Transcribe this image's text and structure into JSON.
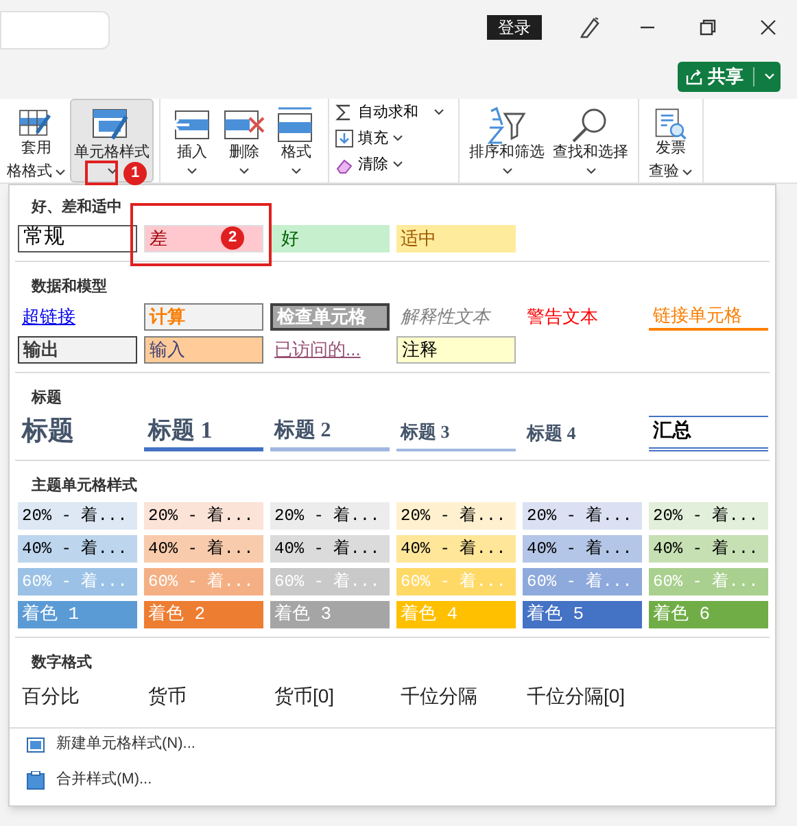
{
  "title_bar": {
    "login_button": "登录"
  },
  "share_button": {
    "label": "共享"
  },
  "ribbon": {
    "groups": [
      {
        "kind": "big",
        "items": [
          {
            "label": "套用",
            "label2": "格格式",
            "selected": false
          },
          {
            "label": "单元格样式",
            "selected": true
          }
        ]
      },
      {
        "kind": "big",
        "items": [
          {
            "label": "插入",
            "selected": false
          },
          {
            "label": "删除",
            "selected": false
          },
          {
            "label": "格式",
            "selected": false
          }
        ]
      },
      {
        "kind": "small",
        "items": [
          {
            "label": "自动求和"
          },
          {
            "label": "填充"
          },
          {
            "label": "清除"
          }
        ]
      },
      {
        "kind": "big",
        "items": [
          {
            "label": "排序和筛选",
            "selected": false
          },
          {
            "label": "查找和选择",
            "selected": false
          }
        ]
      },
      {
        "kind": "big",
        "items": [
          {
            "label": "发票",
            "label2": "查验",
            "selected": false
          }
        ]
      }
    ]
  },
  "style_gallery": {
    "sections": [
      {
        "title": "好、差和适中",
        "rows": [
          [
            {
              "label": "常规",
              "kind": "normal"
            },
            {
              "label": "差",
              "kind": "bad"
            },
            {
              "label": "好",
              "kind": "good"
            },
            {
              "label": "适中",
              "kind": "neutral"
            }
          ]
        ]
      },
      {
        "title": "数据和模型",
        "rows": [
          [
            {
              "label": "超链接",
              "kind": "hyperlink"
            },
            {
              "label": "计算",
              "kind": "calculation"
            },
            {
              "label": "检查单元格",
              "kind": "check"
            },
            {
              "label": "解释性文本",
              "kind": "explanatory"
            },
            {
              "label": "警告文本",
              "kind": "warning"
            },
            {
              "label": "链接单元格",
              "kind": "linked"
            }
          ],
          [
            {
              "label": "输出",
              "kind": "output"
            },
            {
              "label": "输入",
              "kind": "input"
            },
            {
              "label": "已访问的...",
              "kind": "visited"
            },
            {
              "label": "注释",
              "kind": "note"
            }
          ]
        ]
      },
      {
        "title": "标题",
        "rows": [
          [
            {
              "label": "标题",
              "kind": "title"
            },
            {
              "label": "标题 1",
              "kind": "heading1"
            },
            {
              "label": "标题 2",
              "kind": "heading2"
            },
            {
              "label": "标题 3",
              "kind": "heading3"
            },
            {
              "label": "标题 4",
              "kind": "heading4"
            },
            {
              "label": "汇总",
              "kind": "total"
            }
          ]
        ]
      },
      {
        "title": "主题单元格样式",
        "rows": [
          [
            {
              "label": "20% - 着...",
              "kind": "tint",
              "color": "#dde8f4"
            },
            {
              "label": "20% - 着...",
              "kind": "tint",
              "color": "#fbe3d7"
            },
            {
              "label": "20% - 着...",
              "kind": "tint",
              "color": "#ececec"
            },
            {
              "label": "20% - 着...",
              "kind": "tint",
              "color": "#fff1cf"
            },
            {
              "label": "20% - 着...",
              "kind": "tint",
              "color": "#dbe1f2"
            },
            {
              "label": "20% - 着...",
              "kind": "tint",
              "color": "#e2efda"
            }
          ],
          [
            {
              "label": "40% - 着...",
              "kind": "tint",
              "color": "#bdd6ee"
            },
            {
              "label": "40% - 着...",
              "kind": "tint",
              "color": "#f8cbad"
            },
            {
              "label": "40% - 着...",
              "kind": "tint",
              "color": "#dbdbdb"
            },
            {
              "label": "40% - 着...",
              "kind": "tint",
              "color": "#ffe699"
            },
            {
              "label": "40% - 着...",
              "kind": "tint",
              "color": "#b4c6e7"
            },
            {
              "label": "40% - 着...",
              "kind": "tint",
              "color": "#c6e0b4"
            }
          ],
          [
            {
              "label": "60% - 着...",
              "kind": "shade",
              "color": "#9bc2e6"
            },
            {
              "label": "60% - 着...",
              "kind": "shade",
              "color": "#f4b084"
            },
            {
              "label": "60% - 着...",
              "kind": "shade",
              "color": "#c9c9c9"
            },
            {
              "label": "60% - 着...",
              "kind": "shade",
              "color": "#ffd966"
            },
            {
              "label": "60% - 着...",
              "kind": "shade",
              "color": "#8ea9db"
            },
            {
              "label": "60% - 着...",
              "kind": "shade",
              "color": "#a9d08e"
            }
          ],
          [
            {
              "label": "着色 1",
              "kind": "accent",
              "color": "#5b9bd5"
            },
            {
              "label": "着色 2",
              "kind": "accent",
              "color": "#ed7d31"
            },
            {
              "label": "着色 3",
              "kind": "accent",
              "color": "#a5a5a5"
            },
            {
              "label": "着色 4",
              "kind": "accent",
              "color": "#ffc000"
            },
            {
              "label": "着色 5",
              "kind": "accent",
              "color": "#4472c4"
            },
            {
              "label": "着色 6",
              "kind": "accent",
              "color": "#70ad47"
            }
          ]
        ]
      },
      {
        "title": "数字格式",
        "rows": [
          [
            {
              "label": "百分比",
              "kind": "plain"
            },
            {
              "label": "货币",
              "kind": "plain"
            },
            {
              "label": "货币[0]",
              "kind": "plain"
            },
            {
              "label": "千位分隔",
              "kind": "plain"
            },
            {
              "label": "千位分隔[0]",
              "kind": "plain"
            }
          ]
        ]
      }
    ],
    "menu_items": [
      {
        "label": "新建单元格样式(N)..."
      },
      {
        "label": "合并样式(M)..."
      }
    ]
  },
  "callouts": [
    {
      "number": "1"
    },
    {
      "number": "2"
    }
  ]
}
